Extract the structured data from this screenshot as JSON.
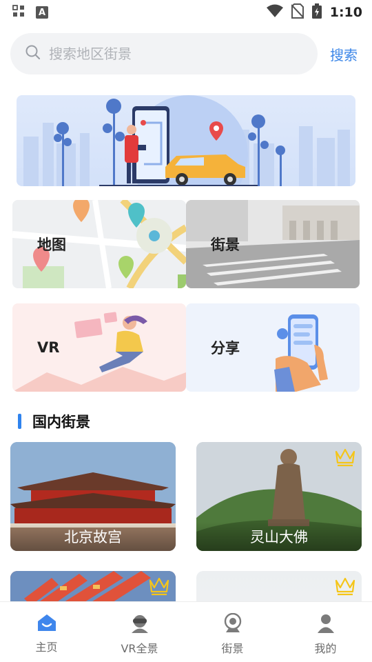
{
  "status_bar": {
    "time": "1:10",
    "notification_icon_text": "A"
  },
  "search": {
    "placeholder": "搜索地区街景",
    "button_label": "搜索"
  },
  "tiles": [
    {
      "label": "地图",
      "icon": "map-icon"
    },
    {
      "label": "街景",
      "icon": "street-view-icon"
    },
    {
      "label": "VR",
      "icon": "vr-icon"
    },
    {
      "label": "分享",
      "icon": "share-icon"
    }
  ],
  "section": {
    "title": "国内街景",
    "accent_color": "#2f83ee"
  },
  "cards": [
    {
      "label": "北京故宫",
      "premium": false
    },
    {
      "label": "灵山大佛",
      "premium": true
    },
    {
      "label": "",
      "premium": true
    },
    {
      "label": "",
      "premium": true
    }
  ],
  "bottom_nav": [
    {
      "label": "主页",
      "icon": "home-icon",
      "active": true
    },
    {
      "label": "VR全景",
      "icon": "vr-panorama-icon",
      "active": false
    },
    {
      "label": "街景",
      "icon": "street-camera-icon",
      "active": false
    },
    {
      "label": "我的",
      "icon": "profile-icon",
      "active": false
    }
  ],
  "colors": {
    "accent": "#3b86e8",
    "crown": "#f5c518"
  }
}
